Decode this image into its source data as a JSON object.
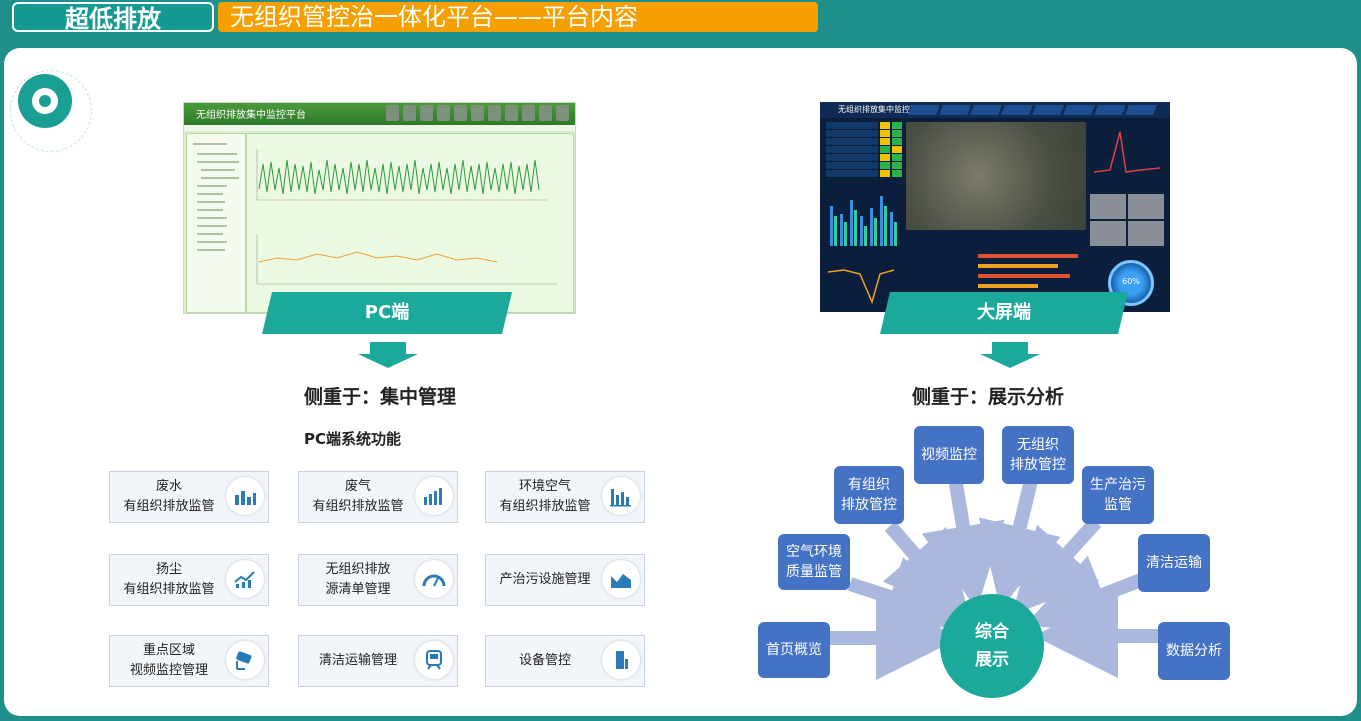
{
  "header": {
    "tag": "超低排放",
    "title": "无组织管控治一体化平台——平台内容"
  },
  "pc": {
    "screenshot_title": "无组织排放集中监控平台",
    "banner": "PC端",
    "focus": "侧重于：集中管理",
    "functions_title": "PC端系统功能",
    "functions": [
      {
        "line1": "废水",
        "line2": "有组织排放监管",
        "icon": "factory-chart-icon"
      },
      {
        "line1": "废气",
        "line2": "有组织排放监管",
        "icon": "bar-chart-icon"
      },
      {
        "line1": "环境空气",
        "line2": "有组织排放监管",
        "icon": "column-chart-icon"
      },
      {
        "line1": "扬尘",
        "line2": "有组织排放监管",
        "icon": "trend-chart-icon"
      },
      {
        "line1": "无组织排放",
        "line2": "源清单管理",
        "icon": "gauge-icon"
      },
      {
        "line1": "产治污设施管理",
        "line2": "",
        "icon": "area-chart-icon"
      },
      {
        "line1": "重点区域",
        "line2": "视频监控管理",
        "icon": "camera-icon"
      },
      {
        "line1": "清洁运输管理",
        "line2": "",
        "icon": "truck-icon"
      },
      {
        "line1": "设备管控",
        "line2": "",
        "icon": "device-icon"
      }
    ]
  },
  "bigscreen": {
    "screenshot_title": "无组织排放集中监控平台",
    "gauge_label": "60%",
    "banner": "大屏端",
    "focus": "侧重于：展示分析",
    "center": {
      "line1": "综合",
      "line2": "展示"
    },
    "nodes": [
      {
        "line1": "首页概览",
        "line2": ""
      },
      {
        "line1": "空气环境",
        "line2": "质量监管"
      },
      {
        "line1": "有组织",
        "line2": "排放管控"
      },
      {
        "line1": "视频监控",
        "line2": ""
      },
      {
        "line1": "无组织",
        "line2": "排放管控"
      },
      {
        "line1": "生产治污",
        "line2": "监管"
      },
      {
        "line1": "清洁运输",
        "line2": ""
      },
      {
        "line1": "数据分析",
        "line2": ""
      }
    ]
  },
  "colors": {
    "teal": "#1aa99a",
    "orange": "#f5a000",
    "blue": "#4472c4",
    "arrow": "#a9b8dc"
  }
}
